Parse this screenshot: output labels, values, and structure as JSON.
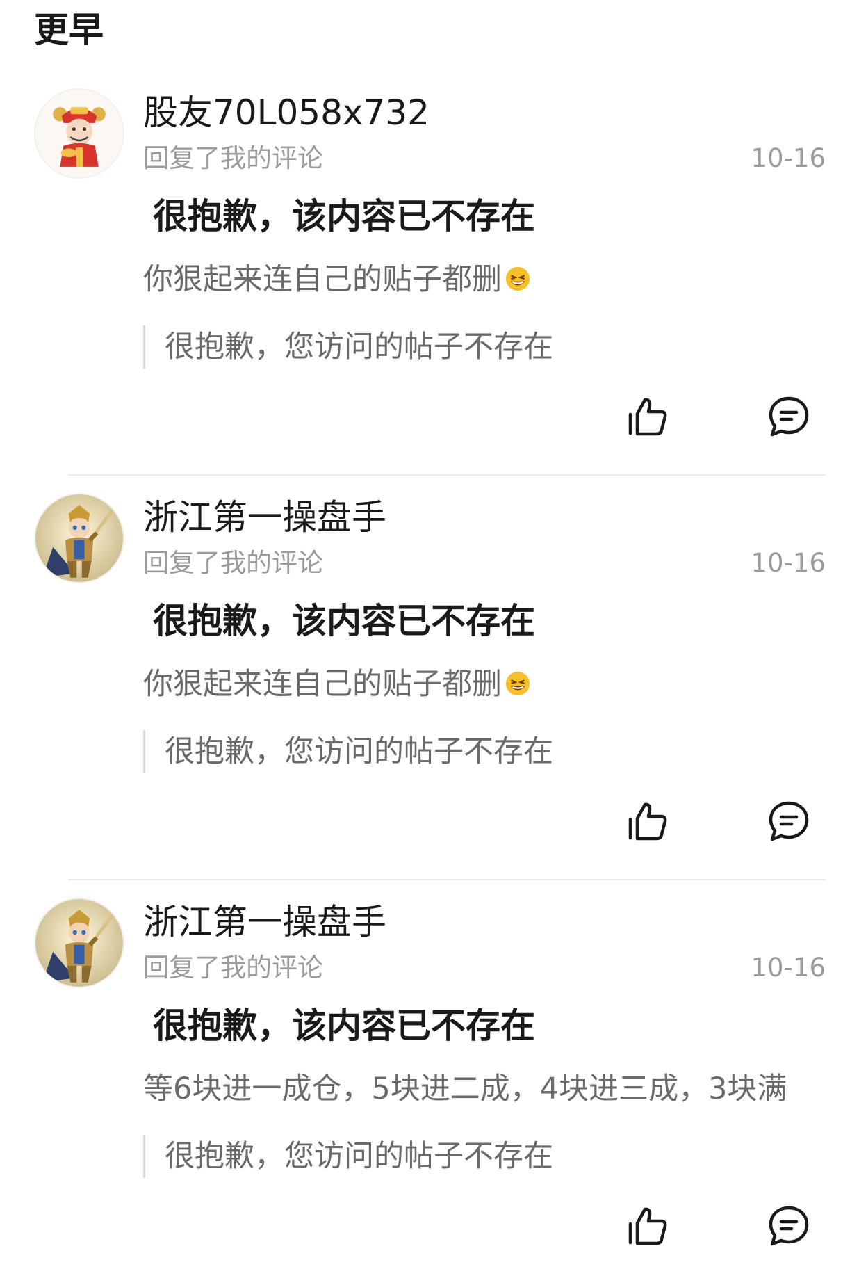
{
  "section": {
    "title": "更早"
  },
  "notifications": [
    {
      "username": "股友70L058x732",
      "action": "回复了我的评论",
      "date": "10-16",
      "headline": "很抱歉，该内容已不存在",
      "body": "你狠起来连自己的贴子都删",
      "has_emoji": true,
      "avatar_icon": "fortune-god-avatar",
      "quote": "很抱歉，您访问的帖子不存在"
    },
    {
      "username": "浙江第一操盘手",
      "action": "回复了我的评论",
      "date": "10-16",
      "headline": "很抱歉，该内容已不存在",
      "body": "你狠起来连自己的贴子都删",
      "has_emoji": true,
      "avatar_icon": "knight-avatar",
      "quote": "很抱歉，您访问的帖子不存在"
    },
    {
      "username": "浙江第一操盘手",
      "action": "回复了我的评论",
      "date": "10-16",
      "headline": "很抱歉，该内容已不存在",
      "body": "等6块进一成仓，5块进二成，4块进三成，3块满",
      "has_emoji": false,
      "avatar_icon": "knight-avatar",
      "quote": "很抱歉，您访问的帖子不存在"
    }
  ],
  "icons": {
    "like": "thumbs-up-icon",
    "comment": "comment-bubble-icon"
  },
  "colors": {
    "primary_text": "#1a1a1a",
    "secondary_text": "#9b9b9b",
    "body_text": "#6a6a6a",
    "divider": "#ececec"
  }
}
